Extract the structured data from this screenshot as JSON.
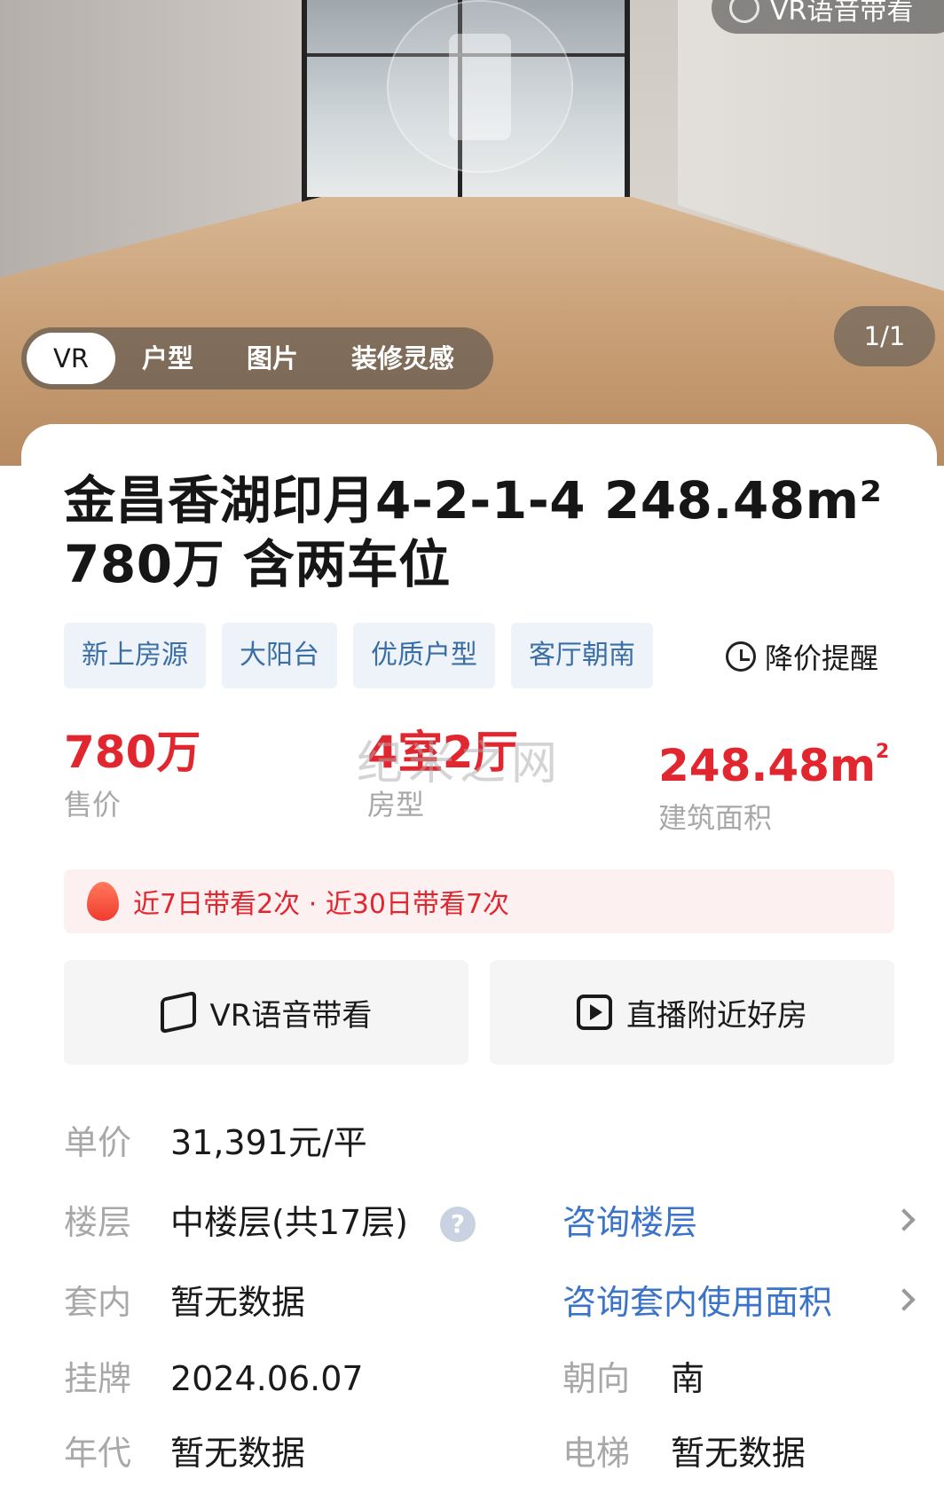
{
  "hero": {
    "vr_audio_chip": "VR语音带看",
    "tabs": [
      {
        "label": "VR"
      },
      {
        "label": "户型"
      },
      {
        "label": "图片"
      },
      {
        "label": "装修灵感"
      }
    ],
    "counter": "1/1"
  },
  "listing": {
    "title_line1": "金昌香湖印月4-2-1-4 248.48m²",
    "title_line2": "780万  含两车位",
    "tags": [
      "新上房源",
      "大阳台",
      "优质户型",
      "客厅朝南"
    ],
    "price_alert": "降价提醒"
  },
  "stats": {
    "price": {
      "value": "780万",
      "label": "售价"
    },
    "layout": {
      "value": "4室2厅",
      "label": "房型"
    },
    "area": {
      "value": "248.48m",
      "sup": "2",
      "label": "建筑面积"
    }
  },
  "watermark": "纪米之网",
  "heat": {
    "text": "近7日带看2次 · 近30日带看7次"
  },
  "actions": {
    "vr": "VR语音带看",
    "live": "直播附近好房"
  },
  "details": {
    "unit_price": {
      "label": "单价",
      "value": "31,391元/平"
    },
    "floor": {
      "label": "楼层",
      "value": "中楼层(共17层)",
      "link": "咨询楼层"
    },
    "inner": {
      "label": "套内",
      "value": "暂无数据",
      "link": "咨询套内使用面积"
    },
    "listed": {
      "label": "挂牌",
      "value": "2024.06.07"
    },
    "orientation": {
      "label": "朝向",
      "value": "南"
    },
    "year": {
      "label": "年代",
      "value": "暂无数据"
    },
    "elevator": {
      "label": "电梯",
      "value": "暂无数据"
    }
  },
  "colors": {
    "accent_red": "#e2262f",
    "link_blue": "#3a73c8",
    "tag_bg": "#eef3f9",
    "tag_text": "#3a6ea5"
  }
}
